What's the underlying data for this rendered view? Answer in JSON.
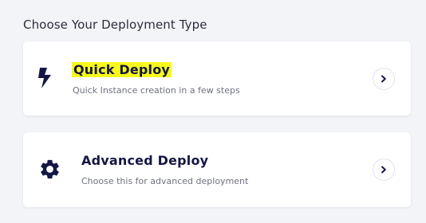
{
  "section": {
    "title": "Choose Your Deployment Type"
  },
  "options": [
    {
      "title": "Quick Deploy",
      "description": "Quick Instance creation in a few steps",
      "icon": "lightning-bolt-icon",
      "highlight_color": "#f6f91b"
    },
    {
      "title": "Advanced Deploy",
      "description": "Choose this for advanced deployment",
      "icon": "gear-icon"
    }
  ],
  "colors": {
    "background": "#f3f4f8",
    "card": "#ffffff",
    "title_text": "#141744",
    "description_text": "#6f7183"
  }
}
